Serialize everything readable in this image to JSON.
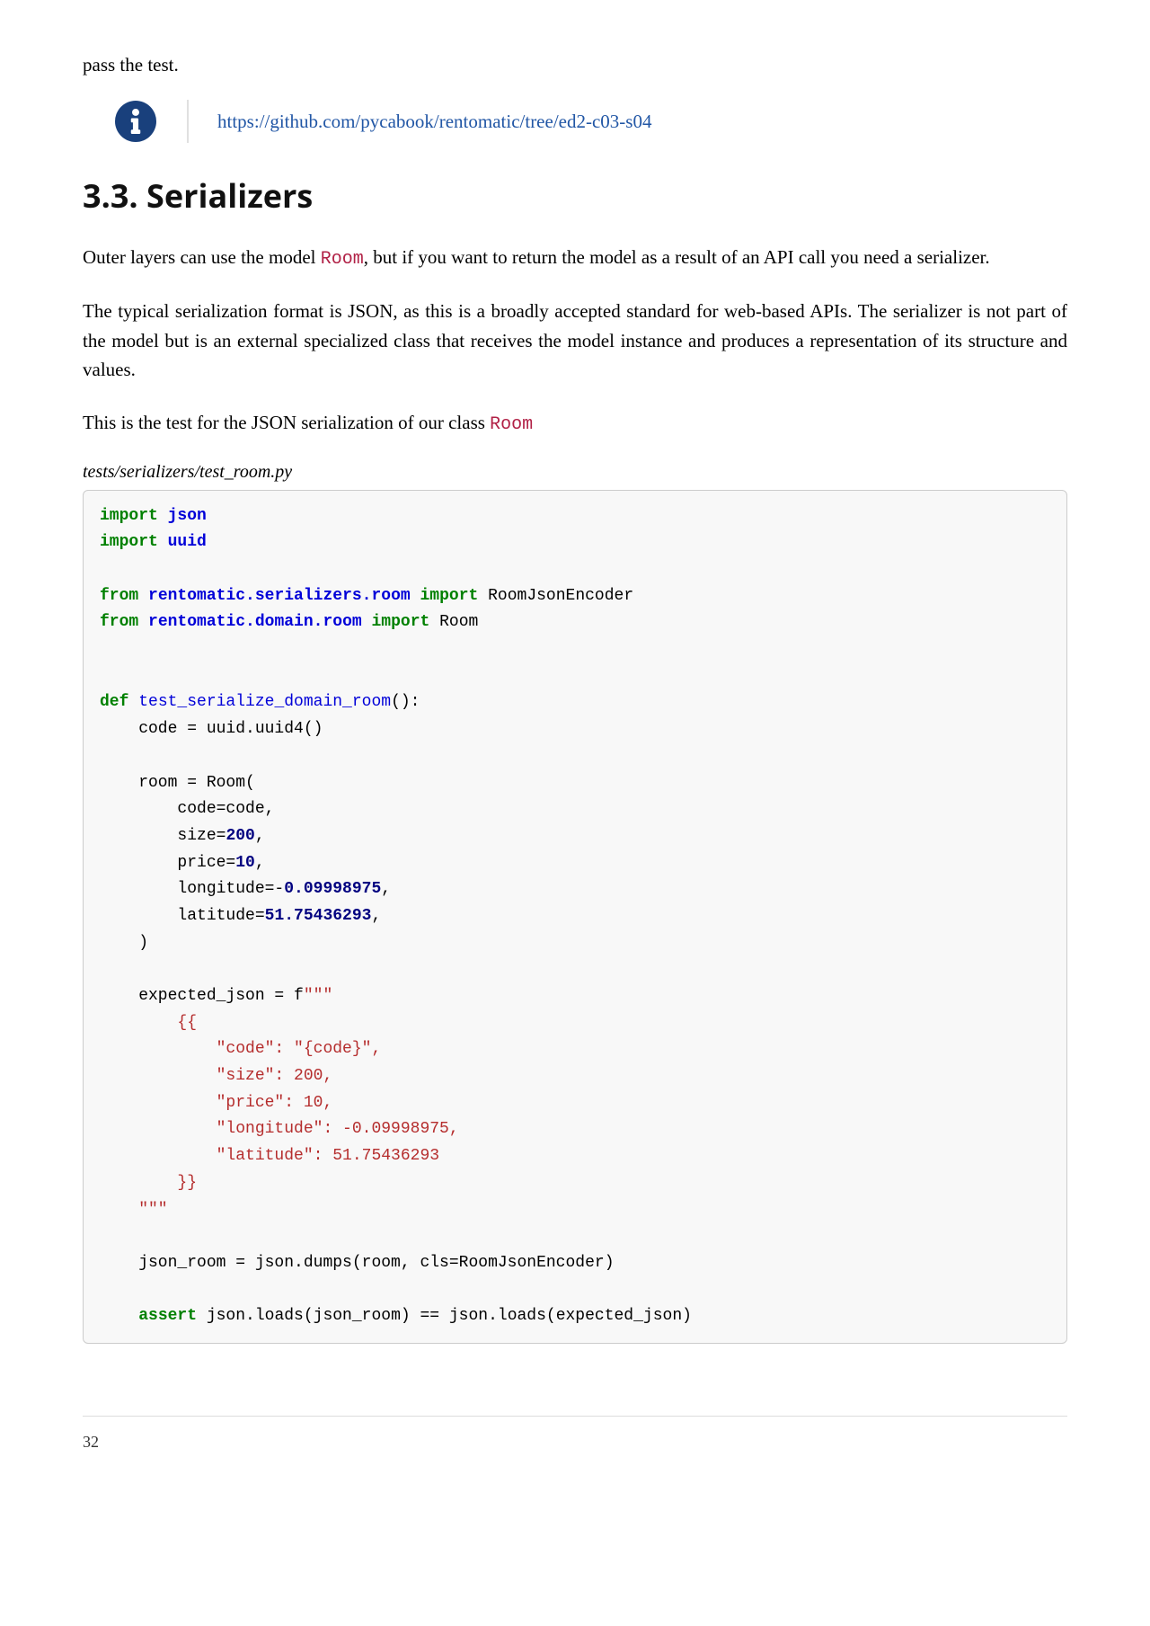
{
  "top_text": "pass the test.",
  "info_link": "https://github.com/pycabook/rentomatic/tree/ed2-c03-s04",
  "section_heading": "3.3. Serializers",
  "para1_a": "Outer layers can use the model ",
  "para1_code": "Room",
  "para1_b": ", but if you want to return the model as a result of an API call you need a serializer.",
  "para2": "The typical serialization format is JSON, as this is a broadly accepted standard for web-based APIs. The serializer is not part of the model but is an external specialized class that receives the model instance and produces a representation of its structure and values.",
  "para3_a": "This is the test for the JSON serialization of our class ",
  "para3_code": "Room",
  "code_title": "tests/serializers/test_room.py",
  "code": {
    "l1_kw1": "import",
    "l1_mod": "json",
    "l2_kw1": "import",
    "l2_mod": "uuid",
    "l3_kw1": "from",
    "l3_mod1": "rentomatic.serializers.room",
    "l3_kw2": "import",
    "l3_name": " RoomJsonEncoder",
    "l4_kw1": "from",
    "l4_mod1": "rentomatic.domain.room",
    "l4_kw2": "import",
    "l4_name": " Room",
    "l5_kw": "def",
    "l5_fn": "test_serialize_domain_room",
    "l5_rest": "():",
    "l6": "    code = uuid.uuid4()",
    "l7": "    room = Room(",
    "l8": "        code=code,",
    "l9a": "        size=",
    "l9n": "200",
    "l9b": ",",
    "l10a": "        price=",
    "l10n": "10",
    "l10b": ",",
    "l11a": "        longitude=-",
    "l11n": "0.09998975",
    "l11b": ",",
    "l12a": "        latitude=",
    "l12n": "51.75436293",
    "l12b": ",",
    "l13": "    )",
    "l14a": "    expected_json = f",
    "l14s": "\"\"\"",
    "l15": "        {{",
    "l16": "            \"code\": \"{code}\",",
    "l17": "            \"size\": 200,",
    "l18": "            \"price\": 10,",
    "l19": "            \"longitude\": -0.09998975,",
    "l20": "            \"latitude\": 51.75436293",
    "l21": "        }}",
    "l22": "    \"\"\"",
    "l23": "    json_room = json.dumps(room, cls=RoomJsonEncoder)",
    "l24_kw": "assert",
    "l24_rest": " json.loads(json_room) == json.loads(expected_json)"
  },
  "page_number": "32"
}
